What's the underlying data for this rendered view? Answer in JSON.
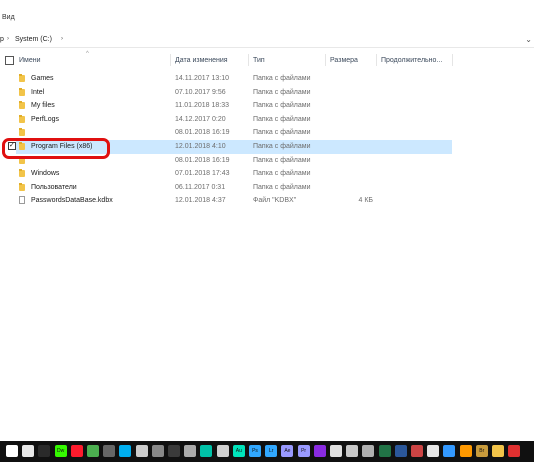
{
  "menu": {
    "view_label": "Вид"
  },
  "address": {
    "prefix": "р",
    "location": "System (C:)",
    "chevron": "›",
    "dropdown": "⌄"
  },
  "columns": {
    "name": "Имени",
    "date": "Дата изменения",
    "type": "Тип",
    "size": "Размера",
    "duration": "Продолжительно..."
  },
  "rows": [
    {
      "name": "Games",
      "date": "14.11.2017 13:10",
      "type": "Папка с файлами",
      "size": "",
      "icon": "folder-icon"
    },
    {
      "name": "Intel",
      "date": "07.10.2017 9:56",
      "type": "Папка с файлами",
      "size": "",
      "icon": "folder-icon"
    },
    {
      "name": "My files",
      "date": "11.01.2018 18:33",
      "type": "Папка с файлами",
      "size": "",
      "icon": "folder-icon"
    },
    {
      "name": "PerfLogs",
      "date": "14.12.2017 0:20",
      "type": "Папка с файлами",
      "size": "",
      "icon": "folder-icon"
    },
    {
      "name": "",
      "date": "08.01.2018 16:19",
      "type": "Папка с файлами",
      "size": "",
      "icon": "folder-icon"
    },
    {
      "name": "Program Files (x86)",
      "date": "12.01.2018 4:10",
      "type": "Папка с файлами",
      "size": "",
      "icon": "folder-icon",
      "selected": true
    },
    {
      "name": "",
      "date": "08.01.2018 16:19",
      "type": "Папка с файлами",
      "size": "",
      "icon": "folder-icon"
    },
    {
      "name": "Windows",
      "date": "07.01.2018 17:43",
      "type": "Папка с файлами",
      "size": "",
      "icon": "folder-icon"
    },
    {
      "name": "Пользователи",
      "date": "06.11.2017 0:31",
      "type": "Папка с файлами",
      "size": "",
      "icon": "folder-icon"
    },
    {
      "name": "PasswordsDataBase.kdbx",
      "date": "12.01.2018 4:37",
      "type": "Файл \"KDBX\"",
      "size": "4 КБ",
      "icon": "file-icon"
    }
  ],
  "taskbar": {
    "icons": [
      {
        "name": "search-icon",
        "color": "#ffffff",
        "label": ""
      },
      {
        "name": "chrome-icon",
        "color": "#e8e8e8",
        "label": ""
      },
      {
        "name": "app-icon",
        "color": "#2a2a2a",
        "label": ""
      },
      {
        "name": "dreamweaver-icon",
        "color": "#35fa00",
        "label": "Dw"
      },
      {
        "name": "opera-icon",
        "color": "#ff1b2d",
        "label": ""
      },
      {
        "name": "chrome-icon",
        "color": "#4caf50",
        "label": ""
      },
      {
        "name": "app-icon",
        "color": "#666666",
        "label": ""
      },
      {
        "name": "skype-icon",
        "color": "#00aff0",
        "label": ""
      },
      {
        "name": "app-icon",
        "color": "#cccccc",
        "label": ""
      },
      {
        "name": "app-icon",
        "color": "#888888",
        "label": ""
      },
      {
        "name": "app-icon",
        "color": "#3a3a3a",
        "label": ""
      },
      {
        "name": "app-icon",
        "color": "#aaaaaa",
        "label": ""
      },
      {
        "name": "app-icon",
        "color": "#00c2a8",
        "label": ""
      },
      {
        "name": "app-icon",
        "color": "#d0d0d0",
        "label": ""
      },
      {
        "name": "audition-icon",
        "color": "#00e4bb",
        "label": "Au"
      },
      {
        "name": "photoshop-icon",
        "color": "#31a8ff",
        "label": "Ps"
      },
      {
        "name": "lightroom-icon",
        "color": "#31a8ff",
        "label": "Lr"
      },
      {
        "name": "aftereffects-icon",
        "color": "#9999ff",
        "label": "Ae"
      },
      {
        "name": "premiere-icon",
        "color": "#9999ff",
        "label": "Pr"
      },
      {
        "name": "app-icon",
        "color": "#8a2be2",
        "label": ""
      },
      {
        "name": "app-icon",
        "color": "#e0e0e0",
        "label": ""
      },
      {
        "name": "app-icon",
        "color": "#c8c8c8",
        "label": ""
      },
      {
        "name": "app-icon",
        "color": "#b0b0b0",
        "label": ""
      },
      {
        "name": "excel-icon",
        "color": "#217346",
        "label": ""
      },
      {
        "name": "word-icon",
        "color": "#2b579a",
        "label": ""
      },
      {
        "name": "app-icon",
        "color": "#cc4444",
        "label": ""
      },
      {
        "name": "app-icon",
        "color": "#e6e6e6",
        "label": ""
      },
      {
        "name": "app-icon",
        "color": "#3399ff",
        "label": ""
      },
      {
        "name": "app-icon",
        "color": "#ff9900",
        "label": ""
      },
      {
        "name": "bridge-icon",
        "color": "#c89b3c",
        "label": "Br"
      },
      {
        "name": "folder-icon",
        "color": "#f2c449",
        "label": ""
      },
      {
        "name": "app-icon",
        "color": "#e03030",
        "label": ""
      }
    ]
  }
}
